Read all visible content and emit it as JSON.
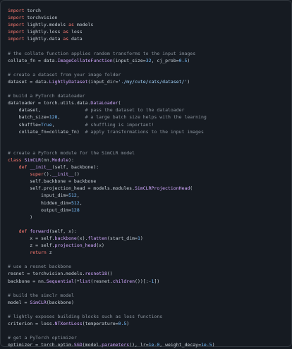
{
  "colors": {
    "background": "#161b22",
    "keyword": "#ff7b72",
    "function": "#d2a8ff",
    "string": "#a5d6ff",
    "number": "#79c0ff",
    "comment": "#8b949e",
    "text": "#c9d1d9"
  },
  "code": {
    "language": "python",
    "lines": [
      [
        [
          "kw",
          "import"
        ],
        [
          "plain",
          " torch"
        ]
      ],
      [
        [
          "kw",
          "import"
        ],
        [
          "plain",
          " torchvision"
        ]
      ],
      [
        [
          "kw",
          "import"
        ],
        [
          "plain",
          " lightly.models "
        ],
        [
          "kw",
          "as"
        ],
        [
          "plain",
          " models"
        ]
      ],
      [
        [
          "kw",
          "import"
        ],
        [
          "plain",
          " lightly.loss "
        ],
        [
          "kw",
          "as"
        ],
        [
          "plain",
          " loss"
        ]
      ],
      [
        [
          "kw",
          "import"
        ],
        [
          "plain",
          " lightly.data "
        ],
        [
          "kw",
          "as"
        ],
        [
          "plain",
          " data"
        ]
      ],
      [],
      [
        [
          "cmt",
          "# the collate function applies random transforms to the input images"
        ]
      ],
      [
        [
          "plain",
          "collate_fn = data."
        ],
        [
          "fn",
          "ImageCollateFunction"
        ],
        [
          "plain",
          "(input_size="
        ],
        [
          "num",
          "32"
        ],
        [
          "plain",
          ", cj_prob="
        ],
        [
          "num",
          "0.5"
        ],
        [
          "plain",
          ")"
        ]
      ],
      [],
      [
        [
          "cmt",
          "# create a dataset from your image folder"
        ]
      ],
      [
        [
          "plain",
          "dataset = data."
        ],
        [
          "fn",
          "LightlyDataset"
        ],
        [
          "plain",
          "(input_dir="
        ],
        [
          "str",
          "'./my/cute/cats/dataset/'"
        ],
        [
          "plain",
          ")"
        ]
      ],
      [],
      [
        [
          "cmt",
          "# build a PyTorch dataloader"
        ]
      ],
      [
        [
          "plain",
          "dataloader = torch.utils.data."
        ],
        [
          "fn",
          "DataLoader"
        ],
        [
          "plain",
          "("
        ]
      ],
      [
        [
          "plain",
          "    dataset,                "
        ],
        [
          "cmt",
          "# pass the dataset to the dataloader"
        ]
      ],
      [
        [
          "plain",
          "    batch_size="
        ],
        [
          "num",
          "128"
        ],
        [
          "plain",
          ",         "
        ],
        [
          "cmt",
          "# a large batch size helps with the learning"
        ]
      ],
      [
        [
          "plain",
          "    shuffle="
        ],
        [
          "num",
          "True"
        ],
        [
          "plain",
          ",           "
        ],
        [
          "cmt",
          "# shuffling is important!"
        ]
      ],
      [
        [
          "plain",
          "    collate_fn=collate_fn)  "
        ],
        [
          "cmt",
          "# apply transformations to the input images"
        ]
      ],
      [],
      [],
      [
        [
          "cmt",
          "# create a PyTorch module for the SimCLR model"
        ]
      ],
      [
        [
          "kw",
          "class"
        ],
        [
          "plain",
          " "
        ],
        [
          "fn",
          "SimCLR"
        ],
        [
          "plain",
          "(nn."
        ],
        [
          "fn",
          "Module"
        ],
        [
          "plain",
          "):"
        ]
      ],
      [
        [
          "plain",
          "    "
        ],
        [
          "kw",
          "def"
        ],
        [
          "plain",
          " "
        ],
        [
          "fn",
          "__init__"
        ],
        [
          "plain",
          "(self, backbone):"
        ]
      ],
      [
        [
          "plain",
          "        "
        ],
        [
          "kw",
          "super"
        ],
        [
          "plain",
          "()."
        ],
        [
          "fn",
          "__init__"
        ],
        [
          "plain",
          "()"
        ]
      ],
      [
        [
          "plain",
          "        self.backbone = backbone"
        ]
      ],
      [
        [
          "plain",
          "        self.projection_head = models.modules."
        ],
        [
          "fn",
          "SimCLRProjectionHead"
        ],
        [
          "plain",
          "("
        ]
      ],
      [
        [
          "plain",
          "            input_dim="
        ],
        [
          "num",
          "512"
        ],
        [
          "plain",
          ","
        ]
      ],
      [
        [
          "plain",
          "            hidden_dim="
        ],
        [
          "num",
          "512"
        ],
        [
          "plain",
          ","
        ]
      ],
      [
        [
          "plain",
          "            output_dim="
        ],
        [
          "num",
          "128"
        ]
      ],
      [
        [
          "plain",
          "        )"
        ]
      ],
      [],
      [
        [
          "plain",
          "    "
        ],
        [
          "kw",
          "def"
        ],
        [
          "plain",
          " "
        ],
        [
          "fn",
          "forward"
        ],
        [
          "plain",
          "(self, x):"
        ]
      ],
      [
        [
          "plain",
          "        x = self."
        ],
        [
          "fn",
          "backbone"
        ],
        [
          "plain",
          "(x)."
        ],
        [
          "fn",
          "flatten"
        ],
        [
          "plain",
          "(start_dim="
        ],
        [
          "num",
          "1"
        ],
        [
          "plain",
          ")"
        ]
      ],
      [
        [
          "plain",
          "        z = self."
        ],
        [
          "fn",
          "projection_head"
        ],
        [
          "plain",
          "(x)"
        ]
      ],
      [
        [
          "plain",
          "        "
        ],
        [
          "kw",
          "return"
        ],
        [
          "plain",
          " z"
        ]
      ],
      [],
      [
        [
          "cmt",
          "# use a resnet backbone"
        ]
      ],
      [
        [
          "plain",
          "resnet = torchvision.models."
        ],
        [
          "fn",
          "resnet18"
        ],
        [
          "plain",
          "()"
        ]
      ],
      [
        [
          "plain",
          "backbone = nn."
        ],
        [
          "fn",
          "Sequential"
        ],
        [
          "plain",
          "(*"
        ],
        [
          "fn",
          "list"
        ],
        [
          "plain",
          "(resnet."
        ],
        [
          "fn",
          "children"
        ],
        [
          "plain",
          "())[:-"
        ],
        [
          "num",
          "1"
        ],
        [
          "plain",
          "])"
        ]
      ],
      [],
      [
        [
          "cmt",
          "# build the simclr model"
        ]
      ],
      [
        [
          "plain",
          "model = "
        ],
        [
          "fn",
          "SimCLR"
        ],
        [
          "plain",
          "(backbone)"
        ]
      ],
      [],
      [
        [
          "cmt",
          "# lightly exposes building blocks such as loss functions"
        ]
      ],
      [
        [
          "plain",
          "criterion = loss."
        ],
        [
          "fn",
          "NTXentLoss"
        ],
        [
          "plain",
          "(temperature="
        ],
        [
          "num",
          "0.5"
        ],
        [
          "plain",
          ")"
        ]
      ],
      [],
      [
        [
          "cmt",
          "# get a PyTorch optimizer"
        ]
      ],
      [
        [
          "plain",
          "optimizer = torch.optim."
        ],
        [
          "fn",
          "SGD"
        ],
        [
          "plain",
          "(model."
        ],
        [
          "fn",
          "parameters"
        ],
        [
          "plain",
          "(), lr="
        ],
        [
          "num",
          "1e-0"
        ],
        [
          "plain",
          ", weight_decay="
        ],
        [
          "num",
          "1e-5"
        ],
        [
          "plain",
          ")"
        ]
      ]
    ]
  }
}
